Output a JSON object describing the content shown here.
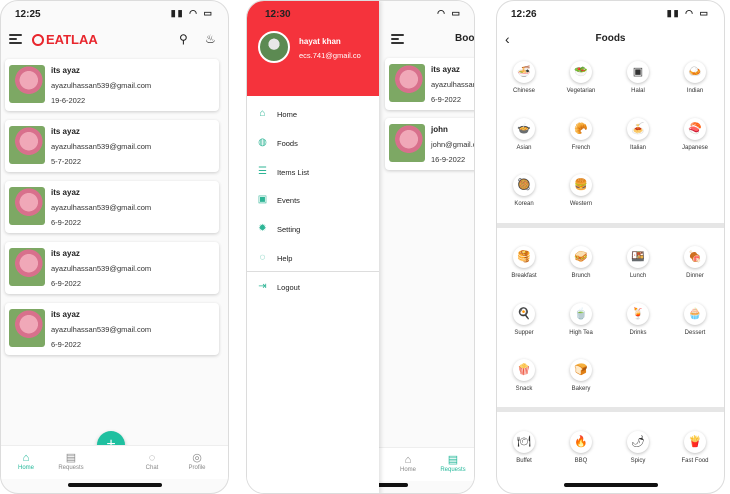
{
  "phone1": {
    "time": "12:25",
    "brand": "EATLAA",
    "cards": [
      {
        "name": "its ayaz",
        "email": "ayazulhassan539@gmail.com",
        "date": "19-6-2022"
      },
      {
        "name": "its ayaz",
        "email": "ayazulhassan539@gmail.com",
        "date": "5-7-2022"
      },
      {
        "name": "its ayaz",
        "email": "ayazulhassan539@gmail.com",
        "date": "6-9-2022"
      },
      {
        "name": "its ayaz",
        "email": "ayazulhassan539@gmail.com",
        "date": "6-9-2022"
      },
      {
        "name": "its ayaz",
        "email": "ayazulhassan539@gmail.com",
        "date": "6-9-2022"
      }
    ],
    "fab": "+",
    "nav": [
      {
        "label": "Home",
        "icon": "home-icon"
      },
      {
        "label": "Requests",
        "icon": "clipboard-icon"
      },
      {
        "label": "Chat",
        "icon": "chat-icon"
      },
      {
        "label": "Profile",
        "icon": "profile-icon"
      }
    ]
  },
  "phone2": {
    "time": "12:30",
    "user_name": "hayat khan",
    "user_email": "ecs.741@gmail.co",
    "menu": [
      {
        "label": "Home",
        "icon": "home-icon"
      },
      {
        "label": "Foods",
        "icon": "foods-icon"
      },
      {
        "label": "Items List",
        "icon": "list-icon"
      },
      {
        "label": "Events",
        "icon": "calendar-icon"
      },
      {
        "label": "Setting",
        "icon": "gear-icon"
      },
      {
        "label": "Help",
        "icon": "help-icon"
      },
      {
        "label": "Logout",
        "icon": "logout-icon"
      }
    ],
    "behind_title": "Book",
    "behind_cards": [
      {
        "name": "its ayaz",
        "email": "ayazulhassan",
        "date": "6-9-2022"
      },
      {
        "name": "john",
        "email": "john@gmail.co",
        "date": "16-9-2022"
      }
    ],
    "behind_nav": [
      {
        "label": "Home"
      },
      {
        "label": "Requests"
      }
    ]
  },
  "phone3": {
    "time": "12:26",
    "title": "Foods",
    "section1": [
      {
        "label": "Chinese",
        "icon": "bowl-icon"
      },
      {
        "label": "Vegetarian",
        "icon": "salad-icon"
      },
      {
        "label": "Halal",
        "icon": "halal-icon"
      },
      {
        "label": "Indian",
        "icon": "curry-icon"
      },
      {
        "label": "Asian",
        "icon": "noodles-icon"
      },
      {
        "label": "French",
        "icon": "croissant-icon"
      },
      {
        "label": "Italian",
        "icon": "pasta-icon"
      },
      {
        "label": "Japanese",
        "icon": "sushi-icon"
      },
      {
        "label": "Korean",
        "icon": "kimchi-icon"
      },
      {
        "label": "Western",
        "icon": "burger-icon"
      }
    ],
    "section2": [
      {
        "label": "Breakfast",
        "icon": "breakfast-icon"
      },
      {
        "label": "Brunch",
        "icon": "brunch-icon"
      },
      {
        "label": "Lunch",
        "icon": "lunch-icon"
      },
      {
        "label": "Dinner",
        "icon": "dinner-icon"
      },
      {
        "label": "Supper",
        "icon": "supper-icon"
      },
      {
        "label": "High Tea",
        "icon": "tea-icon"
      },
      {
        "label": "Drinks",
        "icon": "drinks-icon"
      },
      {
        "label": "Dessert",
        "icon": "cupcake-icon"
      },
      {
        "label": "Snack",
        "icon": "snack-icon"
      },
      {
        "label": "Bakery",
        "icon": "bakery-icon"
      }
    ],
    "section3": [
      {
        "label": "Buffet",
        "icon": "buffet-icon"
      },
      {
        "label": "BBQ",
        "icon": "bbq-icon"
      },
      {
        "label": "Spicy",
        "icon": "chili-icon"
      },
      {
        "label": "Fast Food",
        "icon": "fastfood-icon"
      }
    ]
  },
  "colors": {
    "accent": "#1fc0a0",
    "brand_red": "#e8262d",
    "drawer_red": "#f5333c"
  }
}
